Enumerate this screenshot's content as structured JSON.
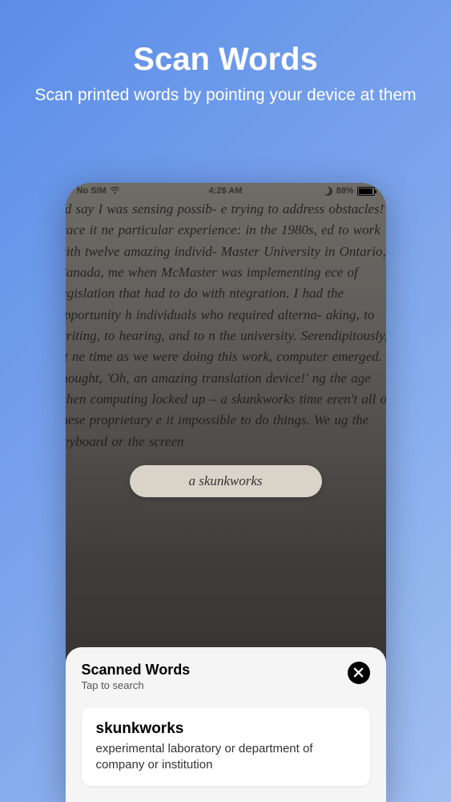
{
  "header": {
    "title": "Scan Words",
    "subtitle": "Scan printed words by pointing your device at them"
  },
  "statusBar": {
    "carrier": "No SIM",
    "time": "4:28 AM",
    "battery": "88%"
  },
  "cameraText": "I'd say I was sensing possib- e trying to address obstacles! I trace it ne particular experience: in the 1980s, ed to work with twelve amazing individ- Master University in Ontario, Canada, me when McMaster was implementing ece of legislation that had to do with ntegration. I had the opportunity h individuals who required alterna- aking, to writing, to hearing, and to n the university. Serendipitously, at ne time as we were doing this work, computer emerged. I thought, 'Oh, an amazing translation device!' ng the age when computing locked up – a skunkworks time eren't all of these proprietary e it impossible to do things. We ug the keyboard or the screen",
  "highlight": {
    "text": "a skunkworks"
  },
  "panel": {
    "title": "Scanned Words",
    "subtitle": "Tap to search",
    "word": "skunkworks",
    "definition": "experimental laboratory or department of company or institution"
  }
}
